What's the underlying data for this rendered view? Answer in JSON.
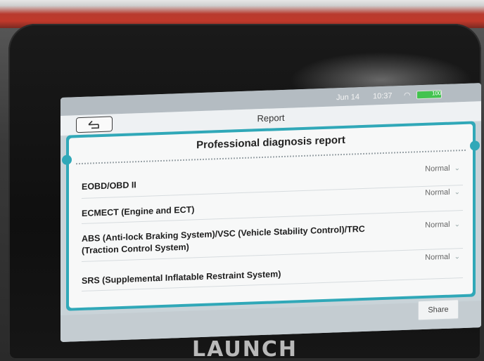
{
  "status_bar": {
    "date": "Jun 14",
    "time": "10:37",
    "battery": "100"
  },
  "header": {
    "title": "Report"
  },
  "report": {
    "heading": "Professional diagnosis report",
    "rows": [
      {
        "label": "EOBD/OBD II",
        "status": "Normal"
      },
      {
        "label": "ECMECT (Engine and ECT)",
        "status": "Normal"
      },
      {
        "label": "ABS (Anti-lock Braking System)/VSC (Vehicle Stability Control)/TRC (Traction Control System)",
        "status": "Normal"
      },
      {
        "label": "SRS (Supplemental Inflatable Restraint System)",
        "status": "Normal"
      }
    ]
  },
  "actions": {
    "share_label": "Share"
  },
  "device": {
    "brand": "LAUNCH"
  },
  "colors": {
    "accent": "#30a8b8",
    "battery": "#43c34f"
  }
}
